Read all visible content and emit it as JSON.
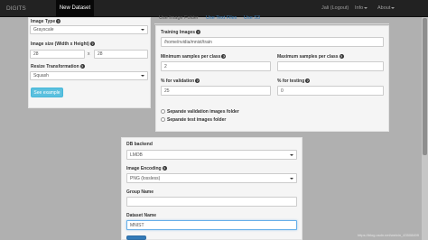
{
  "navbar": {
    "brand": "DIGITS",
    "active_item": "New Dataset",
    "user": "Jali (Logout)",
    "info": "Info",
    "about": "About"
  },
  "left_panel": {
    "image_type_label": "Image Type",
    "image_type_value": "Grayscale",
    "image_size_label": "Image size (Width x Height)",
    "width_value": "28",
    "times": "x",
    "height_value": "28",
    "resize_label": "Resize Transformation",
    "resize_value": "Squash",
    "see_example": "See example"
  },
  "tabs": [
    "Use Image Folder",
    "Use Text Files",
    "Use S3"
  ],
  "image_folder": {
    "training_images_label": "Training Images",
    "training_images_value": "/home/nvidia/mnist/train",
    "min_samples_label": "Minimum samples per class",
    "min_samples_value": "2",
    "max_samples_label": "Maximum samples per class",
    "max_samples_value": "",
    "pct_validation_label": "% for validation",
    "pct_validation_value": "25",
    "pct_testing_label": "% for testing",
    "pct_testing_value": "0",
    "sep_validation_label": "Separate validation images folder",
    "sep_test_label": "Separate test images folder"
  },
  "db_panel": {
    "db_backend_label": "DB backend",
    "db_backend_value": "LMDB",
    "image_encoding_label": "Image Encoding",
    "image_encoding_value": "PNG (lossless)",
    "group_name_label": "Group Name",
    "group_name_value": "",
    "dataset_name_label": "Dataset Name",
    "dataset_name_value": "MNIST"
  },
  "watermark": "https://blog.csdn.net/weixin_43508499",
  "colors": {
    "navbar_bg": "#222222",
    "page_bg": "#b0b0b0",
    "panel_bg": "#f5f5f5",
    "button_info": "#5bc0de",
    "link": "#337ab7",
    "focus_border": "#66afe9"
  },
  "icons": [
    "question-circle-icon",
    "caret-down-icon",
    "select-arrow-icon",
    "radio-icon"
  ]
}
